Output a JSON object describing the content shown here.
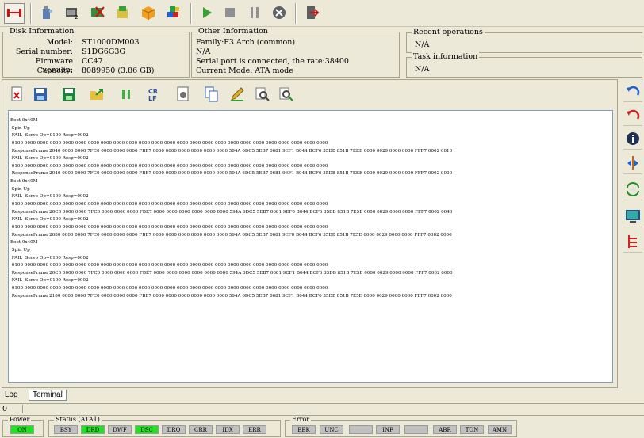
{
  "disk_info": {
    "title": "Disk Information",
    "model_label": "Model:",
    "model": "ST1000DM003",
    "serial_label": "Serial number:",
    "serial": "S1DG6G3G",
    "firmware_label": "Firmware version:",
    "firmware": "CC47",
    "capacity_label": "Capacity:",
    "capacity": "8089950 (3.86 GB)"
  },
  "other_info": {
    "title": "Other Information",
    "family": "Family:F3 Arch (common)",
    "line2": "N/A",
    "serial_port": "Serial port is connected, the rate:38400",
    "mode": "Current Mode: ATA mode"
  },
  "recent_ops": {
    "title": "Recent operations",
    "value": "N/A"
  },
  "task_info": {
    "title": "Task information",
    "value": "N/A"
  },
  "terminal_lines": [
    "Boot 0x40M",
    " Spin Up",
    " FAIL  Servo Op=0100 Resp=0002",
    " 0100 0000 0000 0000 0000 0000 0000 0000 0000 0000 0000 0000 0000 0000 0000 0000 0000 0000 0000 0000 0000 0000 0000 0000 0000",
    " ResponseFrame 2040 0000 0000 7FC0 0000 0000 0000 FBE7 0000 0000 0000 0000 0000 0000 594A 6DC5 5EB7 0681 9EF1 B044 BCF6 35DB 851B 7EEE 0000 0029 0000 0000 FFF7 0002 0010",
    " FAIL  Servo Op=0100 Resp=0002",
    " 0100 0000 0000 0000 0000 0000 0000 0000 0000 0000 0000 0000 0000 0000 0000 0000 0000 0000 0000 0000 0000 0000 0000 0000 0000",
    " ResponseFrame 2040 0000 0000 7FC0 0000 0000 0000 FBE7 0000 0000 0000 0000 0000 0000 594A 6DC5 5EB7 0681 9EF1 B044 BCF6 35DB 851B 7EEE 0000 0029 0000 0000 FFF7 0002 0000",
    "Boot 0x40M",
    " Spin Up",
    " FAIL  Servo Op=0100 Resp=0002",
    " 0100 0000 0000 0000 0000 0000 0000 0000 0000 0000 0000 0000 0000 0000 0000 0000 0000 0000 0000 0000 0000 0000 0000 0000 0000",
    " ResponseFrame 20C0 0000 0000 7FC0 0000 0000 0000 FBE7 0000 0000 0000 0000 0000 0000 594A 6DC5 5EB7 0681 9EF0 B044 BCF6 35DB 851B 7E5E 0000 0029 0000 0000 FFF7 0002 0040",
    " FAIL  Servo Op=0100 Resp=0002",
    " 0100 0000 0000 0000 0000 0000 0000 0000 0000 0000 0000 0000 0000 0000 0000 0000 0000 0000 0000 0000 0000 0000 0000 0000 0000",
    " ResponseFrame 2080 0000 0000 7FC0 0000 0000 0000 FBE7 0000 0000 0000 0000 0000 0000 594A 6DC5 5EB7 0681 9EF0 B044 BCF6 35DB 851B 7E5E 0000 0029 0000 0000 FFF7 0002 0000",
    "Boot 0x40M",
    " Spin Up",
    " FAIL  Servo Op=0100 Resp=0002",
    " 0100 0000 0000 0000 0000 0000 0000 0000 0000 0000 0000 0000 0000 0000 0000 0000 0000 0000 0000 0000 0000 0000 0000 0000 0000",
    " ResponseFrame 20C0 0000 0000 7FC0 0000 0000 0000 FBE7 0000 0000 0000 0000 0000 0000 594A 6DC5 5EB7 0681 9CF1 B044 BCF6 35DB 851B 7E5E 0000 0029 0000 0000 FFF7 0002 0000",
    " FAIL  Servo Op=0100 Resp=0002",
    " 0100 0000 0000 0000 0000 0000 0000 0000 0000 0000 0000 0000 0000 0000 0000 0000 0000 0000 0000 0000 0000 0000 0000 0000 0000",
    " ResponseFrame 2100 0000 0000 7FC0 0000 0000 0000 FBE7 0000 0000 0000 0000 0000 0000 594A 6DC5 5EB7 0681 9CF1 B044 BCF6 35DB 851B 7E5E 0000 0029 0000 0000 FFF7 0002 0000"
  ],
  "tabs": {
    "log": "Log",
    "terminal": "Terminal"
  },
  "progress_value": "0",
  "power": {
    "title": "Power",
    "state": "ON"
  },
  "status": {
    "title": "Status (ATA1)",
    "flags": [
      "BSY",
      "DRD",
      "DWF",
      "DSC",
      "DRQ",
      "CRR",
      "IDX",
      "ERR"
    ]
  },
  "error": {
    "title": "Error",
    "flags": [
      "BBK",
      "UNC",
      "",
      "INF",
      "",
      "ABR",
      "TON",
      "AMN"
    ]
  },
  "colors": {
    "active_green": "#22e022",
    "inactive_gray": "#c0c0c0"
  }
}
